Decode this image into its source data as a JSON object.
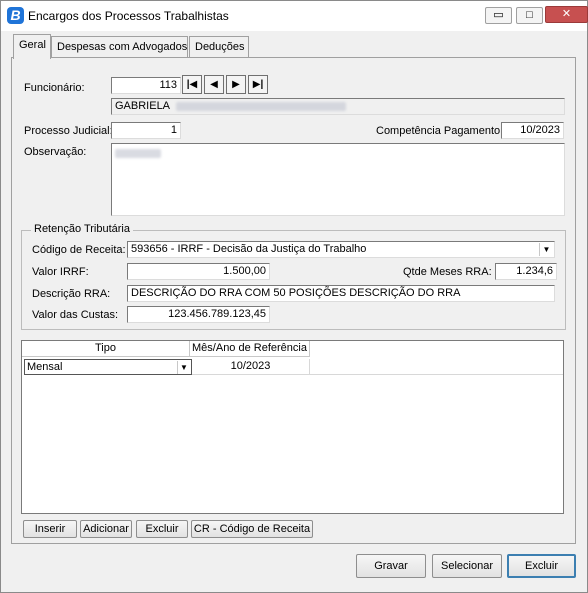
{
  "window": {
    "title": "Encargos dos Processos Trabalhistas",
    "icon_letter": "B",
    "minimize": "▭",
    "maximize": "□",
    "close": "✕"
  },
  "tabs": [
    "Geral",
    "Despesas com Advogados",
    "Deduções"
  ],
  "form": {
    "funcionario_label": "Funcionário:",
    "funcionario_value": "113",
    "nav_first": "|◀",
    "nav_prev": "◀",
    "nav_next": "▶",
    "nav_last": "▶|",
    "employee_name": "GABRIELA",
    "processo_label": "Processo Judicial:",
    "processo_value": "1",
    "competencia_label": "Competência Pagamento:",
    "competencia_value": "10/2023",
    "observacao_label": "Observação:"
  },
  "retencao": {
    "group_title": "Retenção Tributária",
    "codigo_label": "Código de Receita:",
    "codigo_value": "593656 - IRRF - Decisão da Justiça do Trabalho",
    "valor_irrf_label": "Valor IRRF:",
    "valor_irrf_value": "1.500,00",
    "qtde_label": "Qtde Meses RRA:",
    "qtde_value": "1.234,6",
    "descricao_label": "Descrição RRA:",
    "descricao_value": "DESCRIÇÃO DO RRA COM 50 POSIÇÕES DESCRIÇÃO DO RRA",
    "custas_label": "Valor das Custas:",
    "custas_value": "123.456.789.123,45"
  },
  "grid": {
    "columns": [
      "Tipo",
      "Mês/Ano de Referência"
    ],
    "rows": [
      {
        "tipo": "Mensal",
        "referencia": "10/2023"
      }
    ]
  },
  "grid_buttons": [
    "Inserir",
    "Adicionar",
    "Excluir",
    "CR - Código de Receita"
  ],
  "footer_buttons": [
    "Gravar",
    "Selecionar",
    "Excluir"
  ],
  "icons": {
    "dropdown": "chevron-down-icon"
  }
}
